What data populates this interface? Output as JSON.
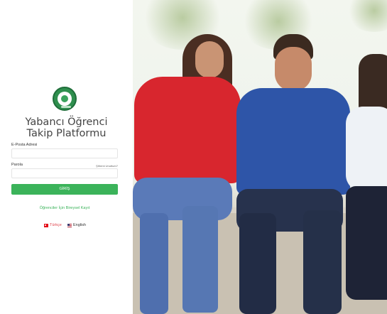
{
  "app": {
    "title_line1": "Yabancı Öğrenci",
    "title_line2": "Takip Platformu"
  },
  "form": {
    "email_label": "E-Posta Adresi",
    "email_value": "",
    "password_label": "Parola",
    "password_value": "",
    "forgot_link": "Şifremi Unuttum?",
    "submit_label": "GİRİŞ"
  },
  "register_link": "Öğrenciler İçin Bireysel Kayıt",
  "languages": [
    {
      "label": "Türkçe",
      "flag": "tr-flag-icon",
      "active": true
    },
    {
      "label": "English",
      "flag": "gb-flag-icon",
      "active": false
    }
  ],
  "colors": {
    "accent": "#3bb35a",
    "active_language": "#e0464f"
  }
}
